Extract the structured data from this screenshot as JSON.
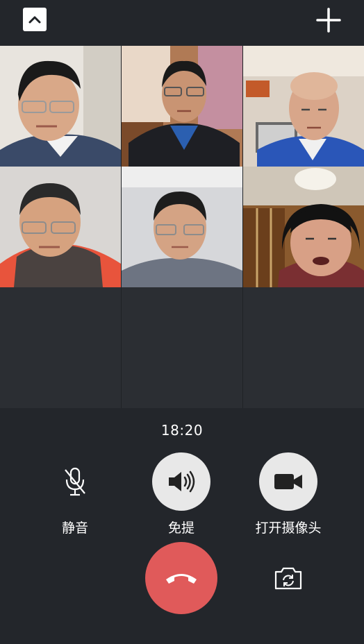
{
  "top_bar": {
    "collapse_icon": "chevron-up-icon",
    "add_icon": "plus-icon"
  },
  "participants": [
    {
      "name": "participant-1",
      "shirt": "#3a4a68",
      "bg": "#e8e4de"
    },
    {
      "name": "participant-2",
      "shirt": "#1e1f24",
      "bg": "#b07a55"
    },
    {
      "name": "participant-3",
      "shirt": "#2a56b8",
      "bg": "#dcd2c6"
    },
    {
      "name": "participant-4",
      "shirt": "#e8543c",
      "bg": "#d9d6d3"
    },
    {
      "name": "participant-5",
      "shirt": "#6d7482",
      "bg": "#d6d7da"
    },
    {
      "name": "participant-6",
      "shirt": "#7a2f32",
      "bg": "#8a5a2e"
    }
  ],
  "call": {
    "timer": "18:20",
    "mute_label": "静音",
    "speaker_label": "免提",
    "camera_label": "打开摄像头",
    "hangup_icon": "phone-hangup-icon",
    "switch_camera_icon": "camera-switch-icon"
  },
  "colors": {
    "hangup": "#e05a5a",
    "control_bg": "#e8e8e8",
    "background": "#23262b"
  }
}
